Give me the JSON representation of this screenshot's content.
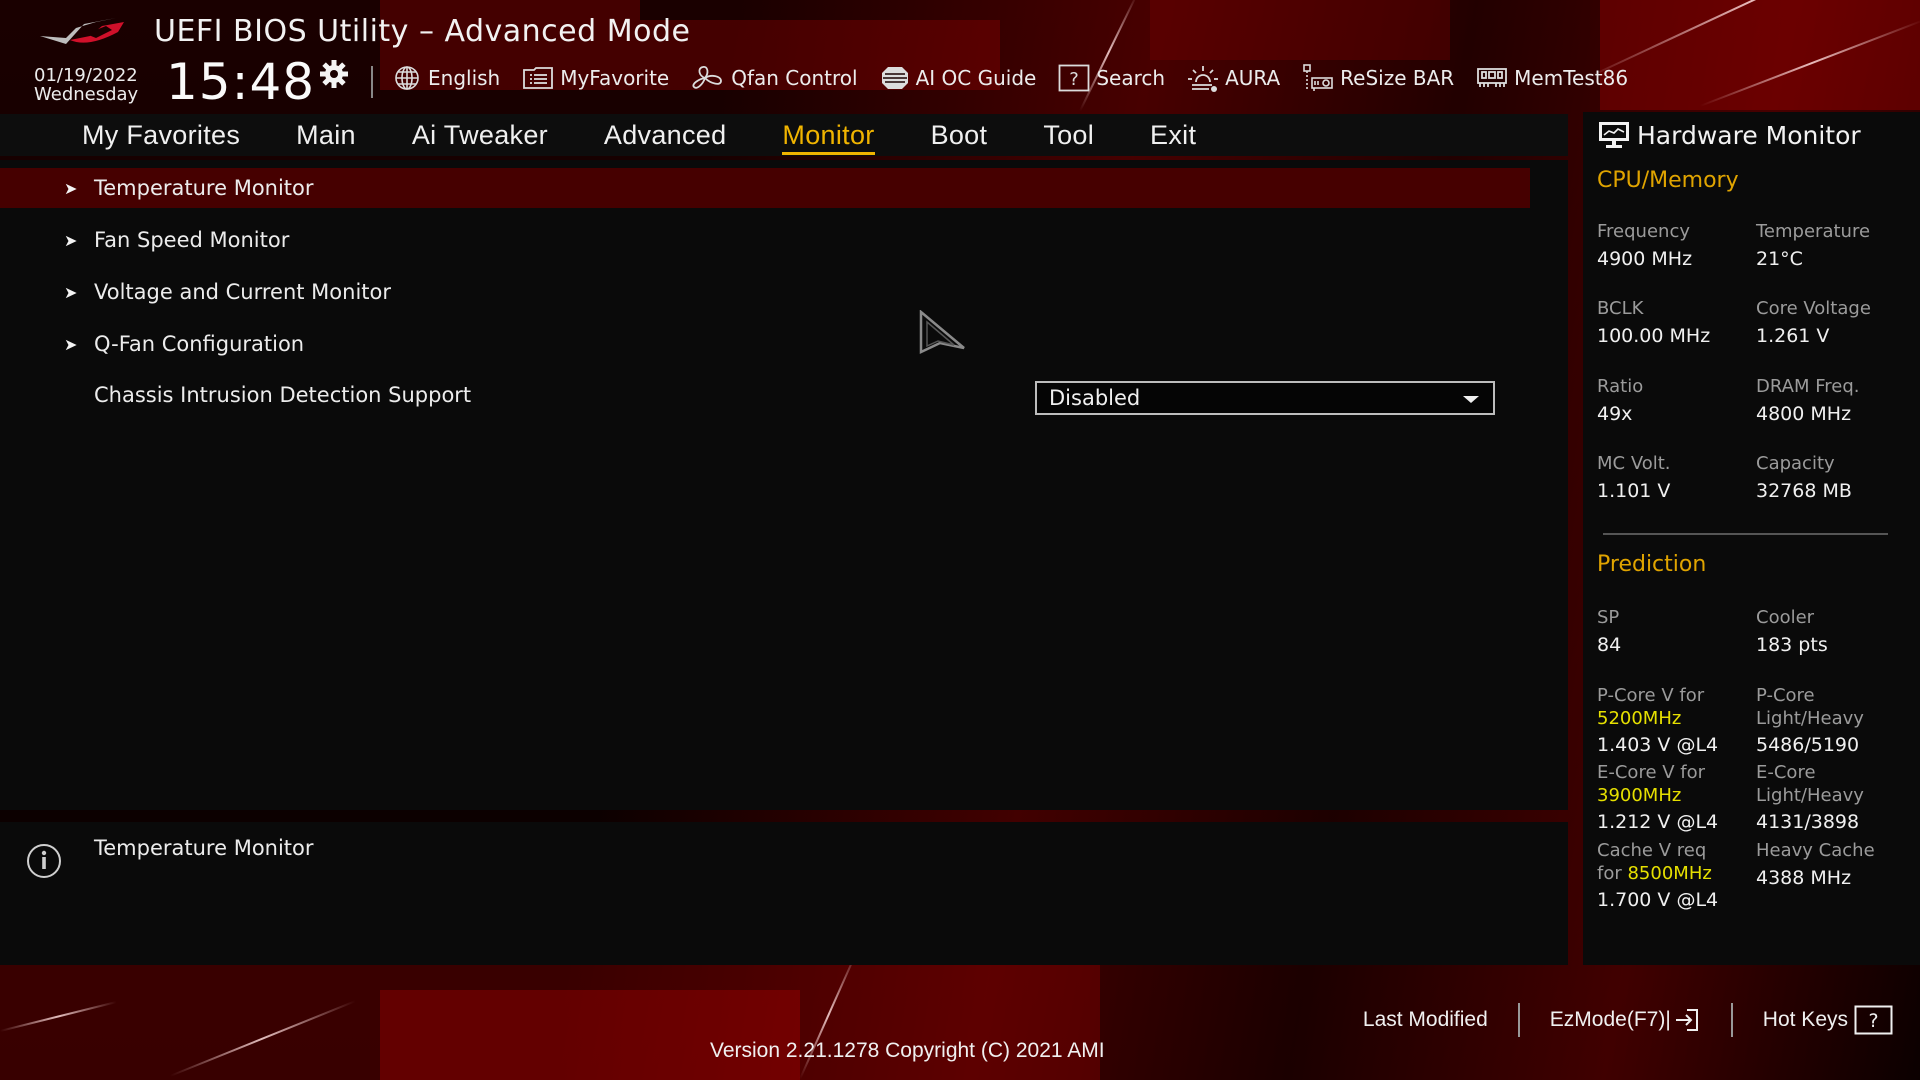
{
  "header": {
    "title": "UEFI BIOS Utility – Advanced Mode",
    "date": "01/19/2022",
    "weekday": "Wednesday",
    "time": "15:48",
    "toolbar": [
      {
        "icon": "globe-icon",
        "label": "English"
      },
      {
        "icon": "favorite-list-icon",
        "label": "MyFavorite"
      },
      {
        "icon": "fan-icon",
        "label": "Qfan Control"
      },
      {
        "icon": "ai-chip-icon",
        "label": "AI OC Guide"
      },
      {
        "icon": "search-help-icon",
        "label": "Search"
      },
      {
        "icon": "aura-light-icon",
        "label": "AURA"
      },
      {
        "icon": "graphics-card-icon",
        "label": "ReSize BAR"
      },
      {
        "icon": "memory-module-icon",
        "label": "MemTest86"
      }
    ]
  },
  "menu": {
    "items": [
      "My Favorites",
      "Main",
      "Ai Tweaker",
      "Advanced",
      "Monitor",
      "Boot",
      "Tool",
      "Exit"
    ],
    "active": "Monitor"
  },
  "main": {
    "rows": [
      {
        "label": "Temperature Monitor",
        "submenu": true,
        "selected": true
      },
      {
        "label": "Fan Speed Monitor",
        "submenu": true,
        "selected": false
      },
      {
        "label": "Voltage and Current Monitor",
        "submenu": true,
        "selected": false
      },
      {
        "label": "Q-Fan Configuration",
        "submenu": true,
        "selected": false
      },
      {
        "label": "Chassis Intrusion Detection Support",
        "submenu": false,
        "selected": false
      }
    ],
    "chassis_select_value": "Disabled",
    "submenu_glyph": "➤"
  },
  "help": {
    "text": "Temperature Monitor"
  },
  "hardware_monitor": {
    "title": "Hardware Monitor",
    "cpu_memory": {
      "heading": "CPU/Memory",
      "items": [
        {
          "label": "Frequency",
          "value": "4900 MHz"
        },
        {
          "label": "Temperature",
          "value": "21°C"
        },
        {
          "label": "BCLK",
          "value": "100.00 MHz"
        },
        {
          "label": "Core Voltage",
          "value": "1.261 V"
        },
        {
          "label": "Ratio",
          "value": "49x"
        },
        {
          "label": "DRAM Freq.",
          "value": "4800 MHz"
        },
        {
          "label": "MC Volt.",
          "value": "1.101 V"
        },
        {
          "label": "Capacity",
          "value": "32768 MB"
        }
      ]
    },
    "prediction": {
      "heading": "Prediction",
      "sp_label": "SP",
      "sp_value": "84",
      "cooler_label": "Cooler",
      "cooler_value": "183 pts",
      "pcore_v_label": "P-Core V for",
      "pcore_v_freq": "5200MHz",
      "pcore_v_value": "1.403 V @L4",
      "pcore_lh_label1": "P-Core",
      "pcore_lh_label2": "Light/Heavy",
      "pcore_lh_value": "5486/5190",
      "ecore_v_label": "E-Core V for",
      "ecore_v_freq": "3900MHz",
      "ecore_v_value": "1.212 V @L4",
      "ecore_lh_label1": "E-Core",
      "ecore_lh_label2": "Light/Heavy",
      "ecore_lh_value": "4131/3898",
      "cache_v_label1": "Cache V req",
      "cache_v_label2": "for",
      "cache_v_freq": "8500MHz",
      "cache_v_value": "1.700 V @L4",
      "heavy_cache_label": "Heavy Cache",
      "heavy_cache_value": "4388 MHz"
    }
  },
  "footer": {
    "last_modified": "Last Modified",
    "ezmode": "EzMode(F7)|",
    "hotkeys": "Hot Keys",
    "version": "Version 2.21.1278 Copyright (C) 2021 AMI"
  },
  "colors": {
    "accent": "#f0b400",
    "selected_row": "#460000",
    "prediction_highlight": "#e6e000"
  }
}
